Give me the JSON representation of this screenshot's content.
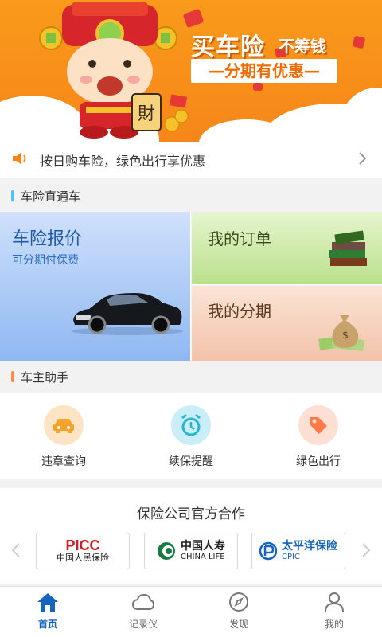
{
  "banner": {
    "title": "买车险",
    "title_suffix": "不筹钱",
    "subtitle": "—分期有优惠—",
    "figure_char": "財"
  },
  "notice": {
    "text": "按日购车险，绿色出行享优惠"
  },
  "sections": {
    "direct": "车险直通车",
    "assistant": "车主助手"
  },
  "tiles": {
    "quote": {
      "title": "车险报价",
      "subtitle": "可分期付保费"
    },
    "orders": {
      "title": "我的订单"
    },
    "installments": {
      "title": "我的分期"
    }
  },
  "assistant_items": [
    {
      "label": "违章查询",
      "icon": "car-icon"
    },
    {
      "label": "续保提醒",
      "icon": "alarm-clock-icon"
    },
    {
      "label": "绿色出行",
      "icon": "tag-icon"
    }
  ],
  "partners": {
    "title": "保险公司官方合作",
    "logos": [
      {
        "main": "PICC",
        "sub": "中国人民保险"
      },
      {
        "main": "中国人寿",
        "sub": "CHINA LIFE"
      },
      {
        "main": "太平洋保险",
        "sub": "CPIC"
      }
    ]
  },
  "tabs": [
    {
      "label": "首页",
      "active": true
    },
    {
      "label": "记录仪",
      "active": false
    },
    {
      "label": "发现",
      "active": false
    },
    {
      "label": "我的",
      "active": false
    }
  ],
  "colors": {
    "banner_orange": "#f7861a",
    "tab_active": "#1565c0",
    "section_bar_blue": "#4fc3f7",
    "section_bar_orange": "#ff8a50"
  }
}
